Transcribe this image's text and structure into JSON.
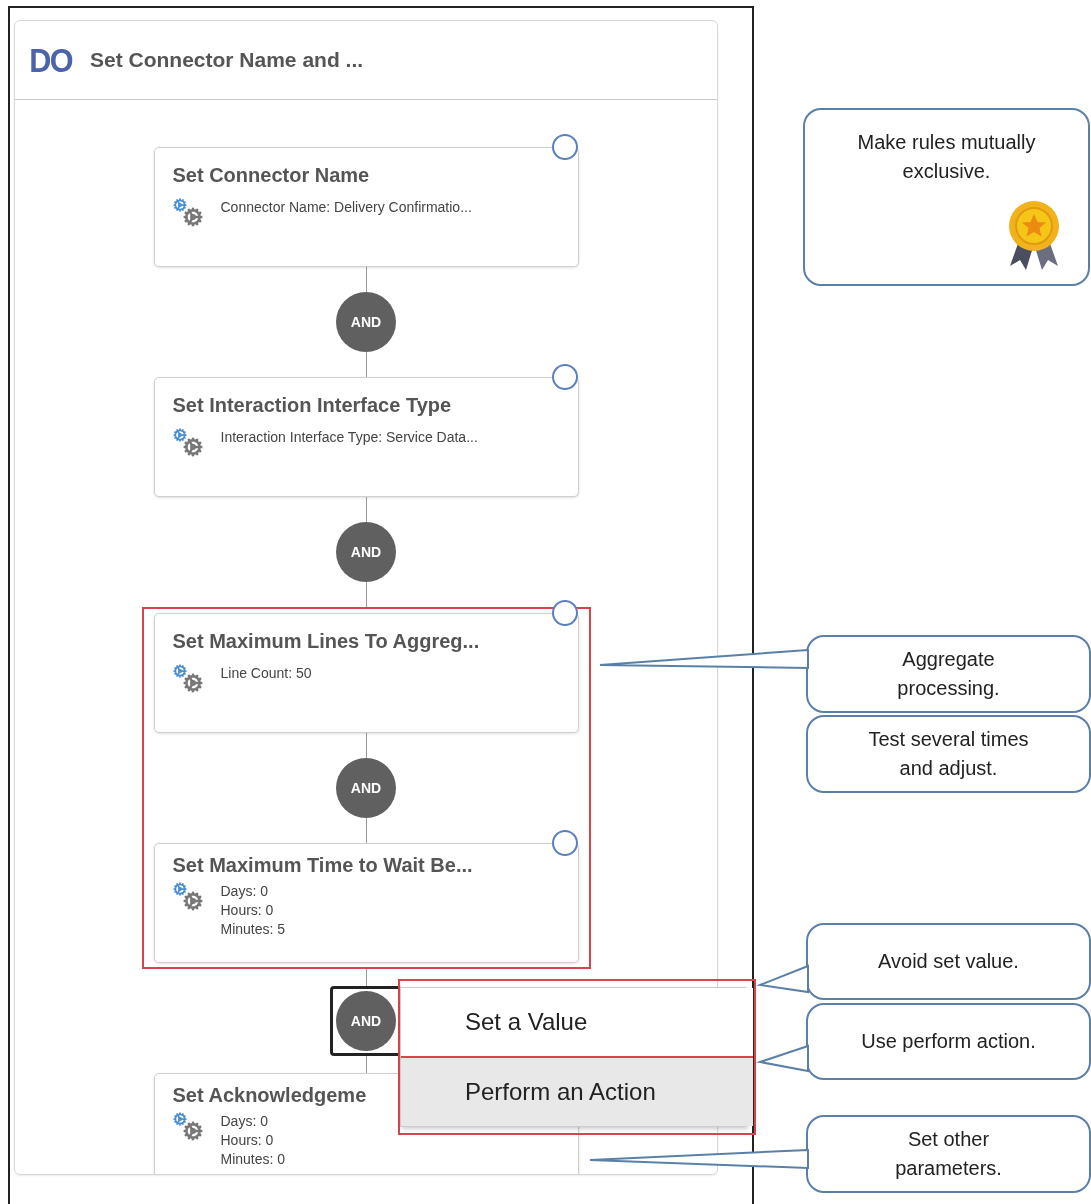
{
  "panel": {
    "badge": "DO",
    "title": "Set Connector Name and ..."
  },
  "nodes": [
    {
      "title": "Set Connector Name",
      "details": [
        "Connector Name: Delivery Confirmatio..."
      ],
      "highlighted": false
    },
    {
      "title": "Set Interaction Interface Type",
      "details": [
        "Interaction Interface Type: Service Data..."
      ],
      "highlighted": false
    },
    {
      "title": "Set Maximum Lines To Aggreg...",
      "details": [
        "Line Count: 50"
      ],
      "highlighted": true
    },
    {
      "title": "Set Maximum Time to Wait Be...",
      "details": [
        "Days: 0",
        "Hours: 0",
        "Minutes: 5"
      ],
      "highlighted": true
    },
    {
      "title": "Set Acknowledgeme",
      "details": [
        "Days: 0",
        "Hours: 0",
        "Minutes: 0"
      ],
      "highlighted": false
    }
  ],
  "connectors": [
    {
      "label": "AND",
      "focused": false
    },
    {
      "label": "AND",
      "focused": false
    },
    {
      "label": "AND",
      "focused": false
    },
    {
      "label": "AND",
      "focused": true
    }
  ],
  "menu": {
    "items": [
      {
        "label": "Set a Value",
        "selected": false
      },
      {
        "label": "Perform an Action",
        "selected": true
      }
    ]
  },
  "callouts": [
    {
      "text": "Make rules mutually exclusive.",
      "kind": "award"
    },
    {
      "text": "Aggregate processing.",
      "kind": "pointer"
    },
    {
      "text": "Test several times and adjust.",
      "kind": "plain"
    },
    {
      "text": "Avoid set value.",
      "kind": "pointer"
    },
    {
      "text": "Use perform action.",
      "kind": "pointer"
    },
    {
      "text": "Set other parameters.",
      "kind": "pointer"
    }
  ]
}
